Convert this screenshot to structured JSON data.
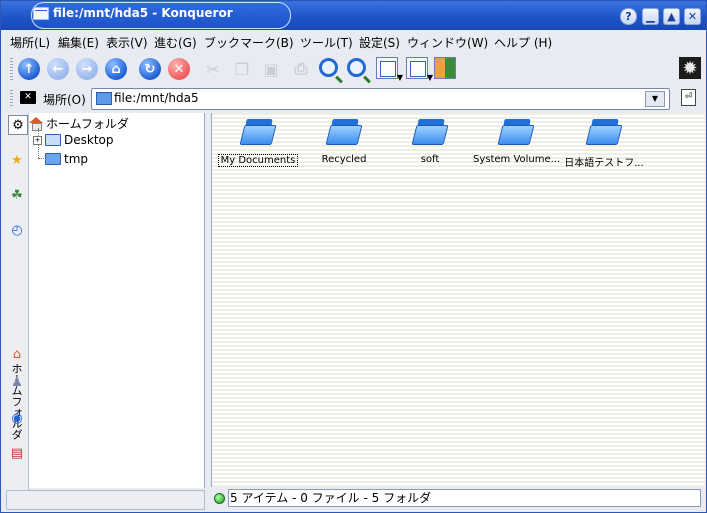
{
  "window": {
    "title": "file:/mnt/hda5 - Konqueror",
    "buttons": [
      "?",
      "▁",
      "▲",
      "✕"
    ]
  },
  "menu": [
    "場所(L)",
    "編集(E)",
    "表示(V)",
    "進む(G)",
    "ブックマーク(B)",
    "ツール(T)",
    "設定(S)",
    "ウィンドウ(W)",
    "ヘルプ (H)"
  ],
  "toolbar": {
    "icons": [
      "up-icon",
      "back-icon",
      "forward-icon",
      "home-icon",
      "reload-icon",
      "stop-icon",
      "cut-icon",
      "copy-icon",
      "paste-icon",
      "print-icon",
      "zoom-in-icon",
      "zoom-out-icon",
      "icon-view-icon",
      "tree-view-icon",
      "multi-column-view-icon"
    ]
  },
  "location": {
    "label": "場所(O)",
    "value": "file:/mnt/hda5"
  },
  "sidebar": {
    "vertical_label": "ホームフォルダ",
    "tree": {
      "root": "ホームフォルダ",
      "children": [
        "Desktop",
        "tmp"
      ]
    }
  },
  "files": {
    "items": [
      {
        "label": "My Documents",
        "selected": true
      },
      {
        "label": "Recycled",
        "selected": false
      },
      {
        "label": "soft",
        "selected": false
      },
      {
        "label": "System Volume...",
        "selected": false
      },
      {
        "label": "日本語テストフ...",
        "selected": false
      }
    ]
  },
  "status": {
    "text": "5 アイテム - 0 ファイル - 5 フォルダ"
  }
}
